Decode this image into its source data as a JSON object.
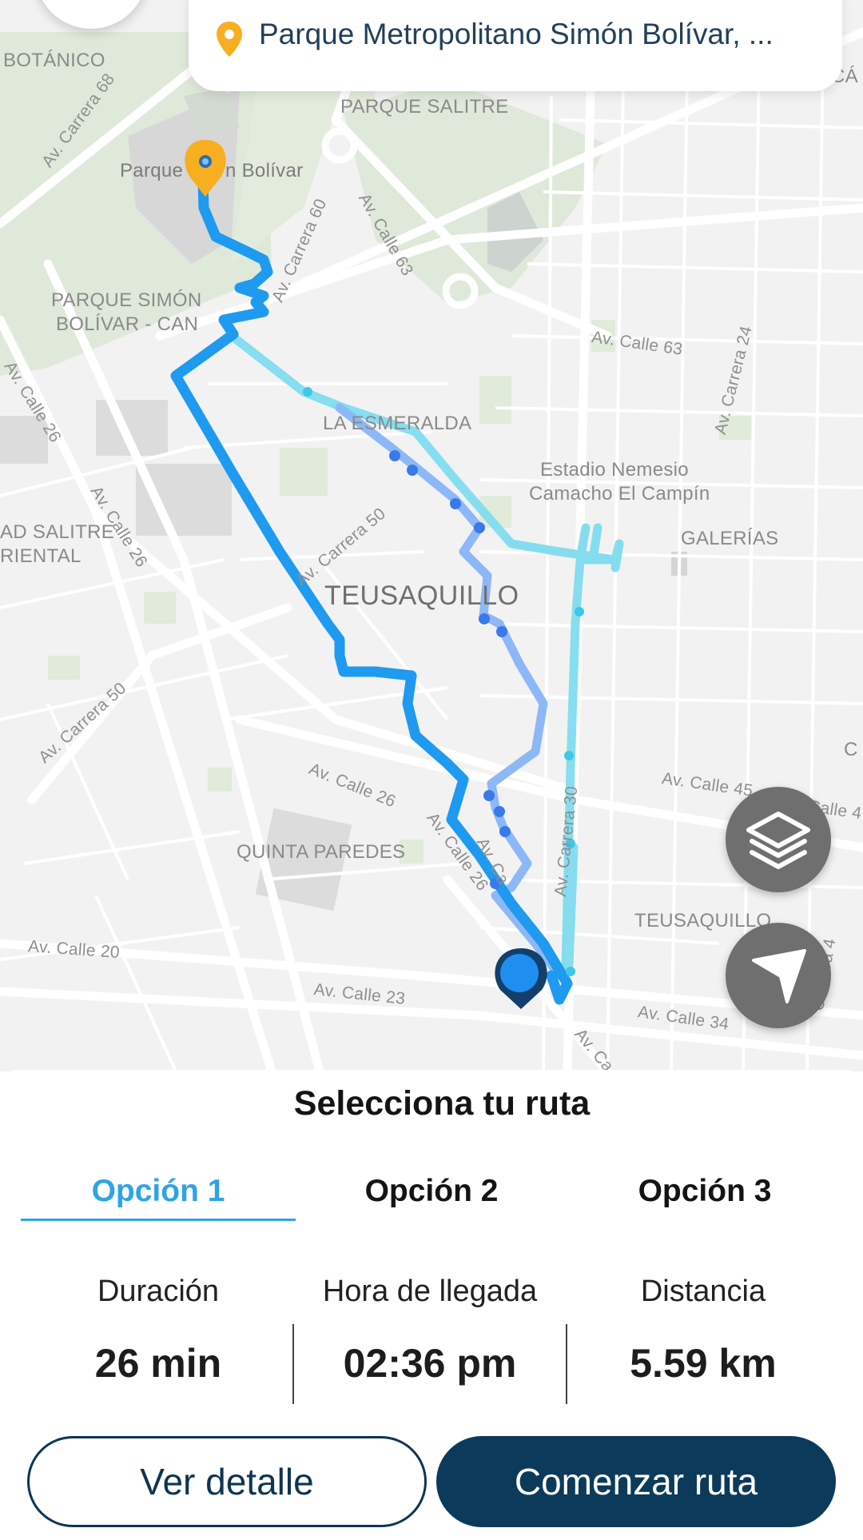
{
  "search": {
    "destination": "Parque Metropolitano Simón Bolívar, ..."
  },
  "map": {
    "labels": {
      "botanico": "BOTÁNICO",
      "parque_salitre": "PARQUE SALITRE",
      "parque_bolivar_a": "Parque",
      "parque_bolivar_b": "n Bolívar",
      "carrera68": "Av. Carrera 68",
      "carrera60": "Av. Carrera 60",
      "calle63": "Av. Calle 63",
      "calle63b": "Av. Calle 63",
      "carrera24": "Av. Carrera 24",
      "can1": "PARQUE SIMÓN",
      "can2": "BOLÍVAR - CAN",
      "calle26a": "Av. Calle 26",
      "calle26b": "Av. Calle 26",
      "esmeralda": "LA ESMERALDA",
      "estadio1": "Estadio Nemesio",
      "estadio2": "Camacho El Campín",
      "galerias": "GALERÍAS",
      "salitre1": "AD SALITRE",
      "salitre2": "RIENTAL",
      "carrera50a": "Av. Carrera 50",
      "carrera50b": "Av. Carrera 50",
      "teusaquillo": "TEUSAQUILLO",
      "calle26c": "Av. Calle 26",
      "calle45": "Av. Calle 45",
      "calle4x": "Av. Calle 4",
      "quinta": "QUINTA PAREDES",
      "calle26d": "Av. Calle 26",
      "carrera30": "Av. Carrera 30",
      "teusaquillo2": "TEUSAQUILLO",
      "calle20": "Av. Calle 20",
      "calle23": "Av. Calle 23",
      "calle34": "Av. Calle 34",
      "carrera4": "Carrera 4",
      "avca": "Av. Ca",
      "avca2": "Av. Ca",
      "edge_c": "C",
      "edge_ca": "CÁ"
    }
  },
  "colors": {
    "route1": "#1e9af0",
    "route2": "#8db8f7",
    "route3": "#7fdcef",
    "origin_pin": "#1268c4",
    "destination_pin": "#f7ae21",
    "primary": "#0c3a5a",
    "accent": "#2da4e6"
  },
  "sheet": {
    "title": "Selecciona tu ruta",
    "tabs": [
      {
        "label": "Opción 1",
        "active": true
      },
      {
        "label": "Opción 2",
        "active": false
      },
      {
        "label": "Opción 3",
        "active": false
      }
    ],
    "stats": [
      {
        "label": "Duración",
        "value": "26 min"
      },
      {
        "label": "Hora de llegada",
        "value": "02:36 pm"
      },
      {
        "label": "Distancia",
        "value": "5.59 km"
      }
    ],
    "buttons": {
      "detail": "Ver detalle",
      "start": "Comenzar ruta"
    }
  },
  "icons": [
    "location-pin-icon",
    "layers-icon",
    "navigation-arrow-icon",
    "destination-pin-icon",
    "origin-pin-icon"
  ]
}
